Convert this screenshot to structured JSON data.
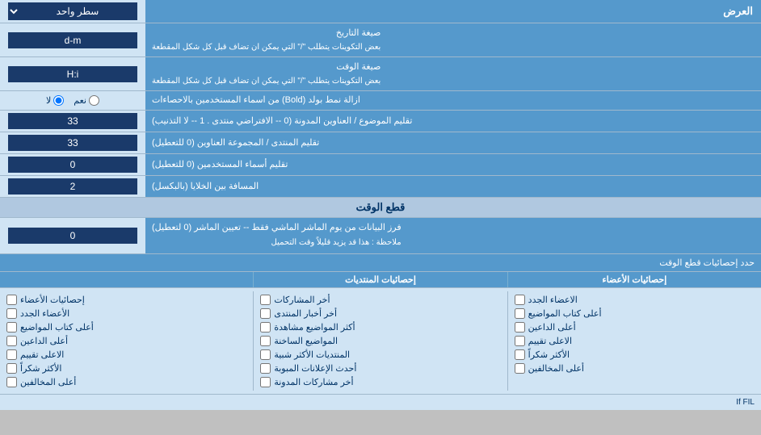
{
  "header": {
    "عرض_label": "العرض",
    "سطر_واحد": "سطر واحد"
  },
  "rows": [
    {
      "label": "صيغة التاريخ\nبعض التكوينات يتطلب \"/\" التي يمكن ان تضاف قبل كل شكل المقطعة",
      "input": "d-m"
    },
    {
      "label": "صيغة الوقت\nبعض التكوينات يتطلب \"/\" التي يمكن ان تضاف قبل كل شكل المقطعة",
      "input": "H:i"
    },
    {
      "label": "ازالة نمط بولد (Bold) من اسماء المستخدمين بالاحصاءات",
      "radio": true,
      "radio_yes": "نعم",
      "radio_no": "لا",
      "selected": "no"
    },
    {
      "label": "تقليم الموضوع / العناوين المدونة (0 -- الافتراضي منتدى . 1 -- لا التذنيب)",
      "input": "33"
    },
    {
      "label": "تقليم المنتدى / المجموعة العناوين (0 للتعطيل)",
      "input": "33"
    },
    {
      "label": "تقليم أسماء المستخدمين (0 للتعطيل)",
      "input": "0"
    },
    {
      "label": "المسافة بين الخلايا (بالبكسل)",
      "input": "2"
    }
  ],
  "section_realtime": {
    "title": "قطع الوقت",
    "row_label": "فرز البيانات من يوم الماشر الماشي فقط -- تعيين الماشر (0 لتعطيل)\nملاحظة : هذا قد يزيد قليلاً وقت التحميل",
    "input": "0"
  },
  "stats_header": "حدد إحصائيات قطع الوقت",
  "col1_header": "إحصائيات الأعضاء",
  "col2_header": "إحصائيات المنتديات",
  "col3_header": "",
  "col1_items": [
    "الاعضاء الجدد",
    "أعلى كتاب المواضيع",
    "أعلى الداعين",
    "الاعلى تقييم",
    "الأكثر شكراً",
    "أعلى المخالفين"
  ],
  "col1_checkboxes": [
    {
      "label": "الاعضاء الجدد",
      "checked": false
    },
    {
      "label": "أعلى كتاب المواضيع",
      "checked": false
    },
    {
      "label": "أعلى الداعين",
      "checked": false
    },
    {
      "label": "الاعلى تقييم",
      "checked": false
    },
    {
      "label": "الأكثر شكراً",
      "checked": false
    },
    {
      "label": "أعلى المخالفين",
      "checked": false
    }
  ],
  "col2_checkboxes": [
    {
      "label": "أخر المشاركات",
      "checked": false
    },
    {
      "label": "أخر أخبار المنتدى",
      "checked": false
    },
    {
      "label": "أكثر المواضيع مشاهدة",
      "checked": false
    },
    {
      "label": "المواضيع الساخنة",
      "checked": false
    },
    {
      "label": "المنتديات الأكثر شبية",
      "checked": false
    },
    {
      "label": "أحدث الإعلانات المبوبة",
      "checked": false
    },
    {
      "label": "أخر مشاركات المدونة",
      "checked": false
    }
  ],
  "col3_checkboxes": [
    {
      "label": "إحصائيات الأعضاء",
      "checked": false
    },
    {
      "label": "الأعضاء الجدد",
      "checked": false
    },
    {
      "label": "أعلى كتاب المواضيع",
      "checked": false
    },
    {
      "label": "أعلى الداعين",
      "checked": false
    },
    {
      "label": "الاعلى تقييم",
      "checked": false
    },
    {
      "label": "الأكثر شكراً",
      "checked": false
    },
    {
      "label": "أعلى المخالفين",
      "checked": false
    }
  ]
}
